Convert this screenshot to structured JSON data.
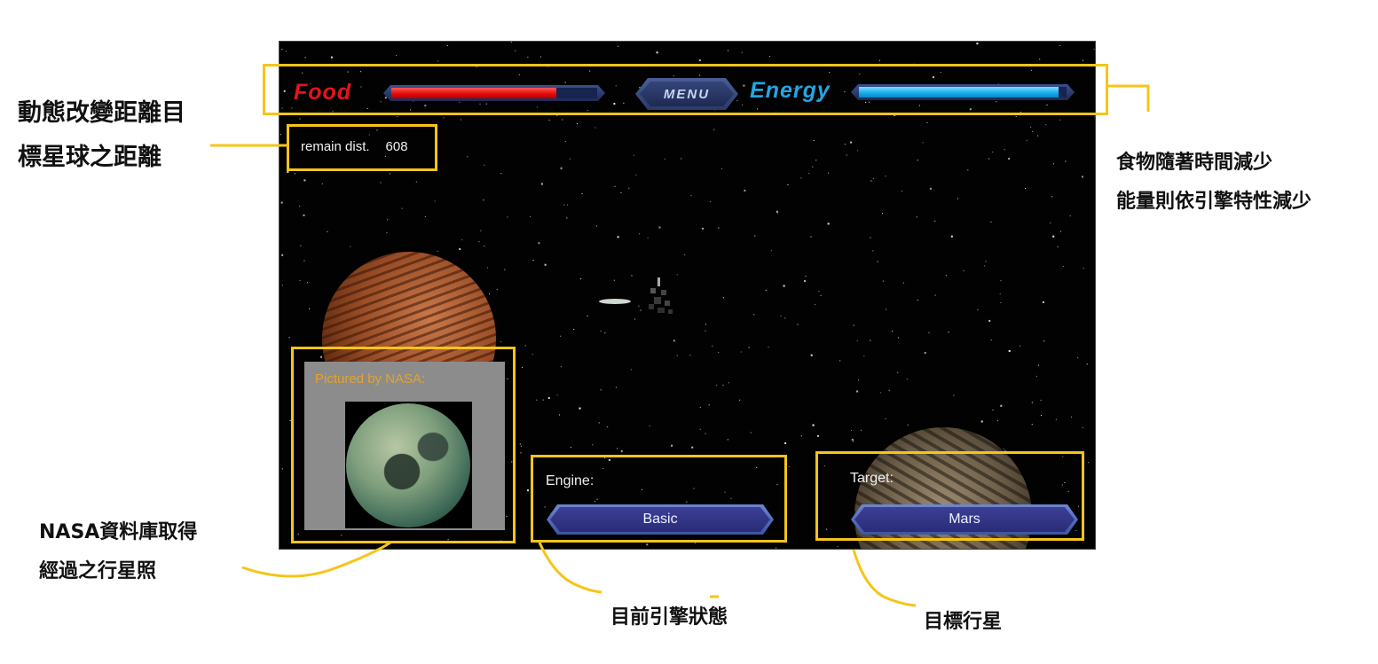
{
  "hud": {
    "food_label": "Food",
    "food_level": 0.8,
    "energy_label": "Energy",
    "energy_level": 0.96,
    "menu_label": "MENU",
    "food_color": "#e8121a",
    "energy_color": "#22a6e6"
  },
  "distance": {
    "label": "remain dist.",
    "value": "608"
  },
  "nasa": {
    "caption": "Pictured by NASA:"
  },
  "engine": {
    "label": "Engine:",
    "value": "Basic"
  },
  "target": {
    "label": "Target:",
    "value": "Mars"
  },
  "annotations": {
    "distance_line1": "動態改變距離目",
    "distance_line2": "標星球之距離",
    "resources_line1": "食物隨著時間減少",
    "resources_line2": "能量則依引擎特性減少",
    "nasa_line1": "NASA資料庫取得",
    "nasa_line2": "經過之行星照",
    "engine_note": "目前引擎狀態",
    "target_note": "目標行星",
    "highlight_color": "#f5c518"
  }
}
